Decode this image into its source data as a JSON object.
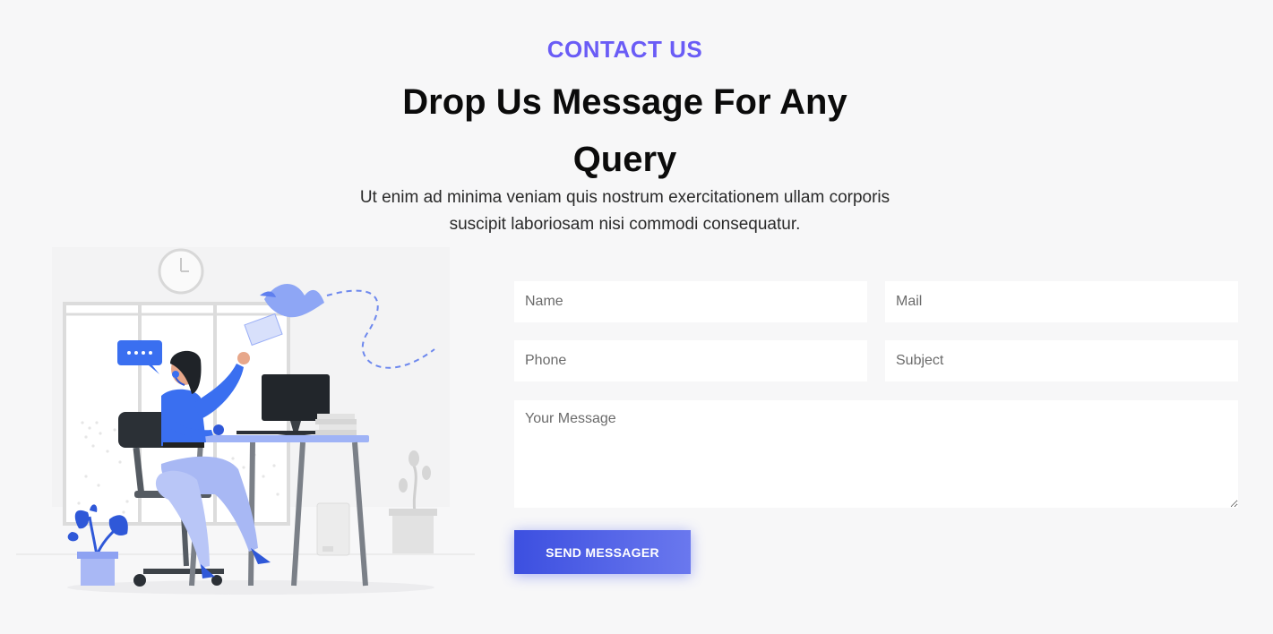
{
  "header": {
    "eyebrow": "CONTACT US",
    "title_line1": "Drop Us Message For Any",
    "title_line2": "Query",
    "subtitle_line1": "Ut enim ad minima veniam quis nostrum exercitationem ullam corporis",
    "subtitle_line2": "suscipit laboriosam nisi commodi consequatur."
  },
  "form": {
    "name_placeholder": "Name",
    "mail_placeholder": "Mail",
    "phone_placeholder": "Phone",
    "subject_placeholder": "Subject",
    "message_placeholder": "Your Message",
    "submit_label": "SEND MESSAGER"
  },
  "colors": {
    "accent": "#6a5cf6",
    "button_start": "#3c4fe0",
    "button_end": "#6a78ee",
    "background": "#f7f7f8"
  },
  "illustration": {
    "icon": "customer-support-illustration"
  }
}
